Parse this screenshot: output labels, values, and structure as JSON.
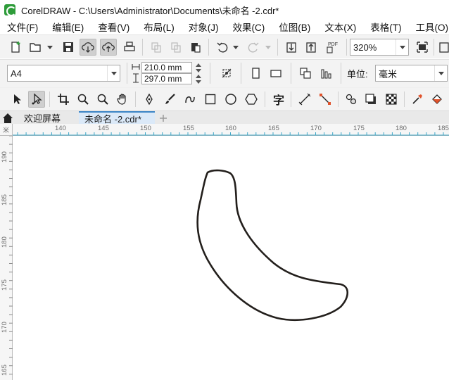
{
  "window": {
    "title": "CorelDRAW - C:\\Users\\Administrator\\Documents\\未命名 -2.cdr*"
  },
  "menu": [
    {
      "label": "文件(F)"
    },
    {
      "label": "编辑(E)"
    },
    {
      "label": "查看(V)"
    },
    {
      "label": "布局(L)"
    },
    {
      "label": "对象(J)"
    },
    {
      "label": "效果(C)"
    },
    {
      "label": "位图(B)"
    },
    {
      "label": "文本(X)"
    },
    {
      "label": "表格(T)"
    },
    {
      "label": "工具(O)"
    }
  ],
  "standard_toolbar": {
    "zoom": "320%",
    "publish_pdf_label": "PDF"
  },
  "property_bar": {
    "page_size": "A4",
    "width": "210.0 mm",
    "height": "297.0 mm",
    "units_label": "单位:",
    "units_value": "毫米"
  },
  "toolbox": {
    "text_tool_glyph": "字"
  },
  "tabs": [
    {
      "label": "欢迎屏幕",
      "active": false
    },
    {
      "label": "未命名 -2.cdr*",
      "active": true
    }
  ],
  "rulers": {
    "unit_glyph": "米",
    "top": [
      "140",
      "145",
      "150",
      "155",
      "160",
      "165",
      "170",
      "175",
      "180",
      "185"
    ],
    "left": [
      "190",
      "185",
      "180",
      "175",
      "170",
      "165"
    ]
  },
  "icons": {
    "new_document": "new-document-icon",
    "open": "open-folder-icon",
    "save": "save-icon",
    "cloud_download": "cloud-download-icon",
    "cloud_upload": "cloud-upload-icon",
    "print": "print-icon",
    "undo": "undo-icon",
    "redo": "redo-icon",
    "import": "import-icon",
    "export": "export-icon",
    "full_screen": "full-screen-icon",
    "pick": "pick-tool-icon",
    "shape": "shape-tool-icon",
    "crop": "crop-tool-icon",
    "zoom": "zoom-tool-icon",
    "pan": "pan-tool-icon",
    "pen": "pen-tool-icon",
    "brush": "artistic-media-icon",
    "bezier": "bezier-tool-icon",
    "rectangle": "rectangle-tool-icon",
    "ellipse": "ellipse-tool-icon",
    "polygon": "polygon-tool-icon",
    "connector": "connector-tool-icon",
    "blend": "blend-tool-icon",
    "shadow": "drop-shadow-icon",
    "transparency": "transparency-icon",
    "eyedropper": "eyedropper-icon",
    "fill": "interactive-fill-icon",
    "home": "home-icon",
    "add_tab": "add-tab-icon"
  },
  "colors": {
    "toolbar_bg": "#f3f3f3",
    "active_tab_bg": "#dbe9f8",
    "ruler_accent": "#3ea7c7",
    "curve_stroke": "#231f1c",
    "app_brand": "#2e9c3a"
  }
}
